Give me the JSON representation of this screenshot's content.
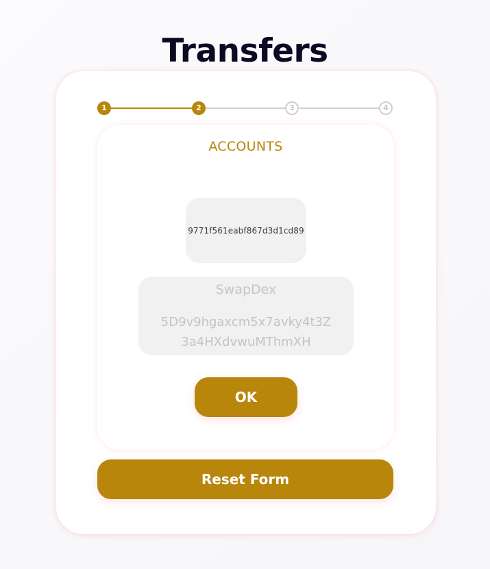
{
  "page": {
    "title": "Transfers"
  },
  "stepper": {
    "steps": [
      {
        "label": "1",
        "state": "completed"
      },
      {
        "label": "2",
        "state": "current"
      },
      {
        "label": "3",
        "state": "pending"
      },
      {
        "label": "4",
        "state": "pending"
      }
    ],
    "active_color": "#b8860b",
    "inactive_color": "#cfcfcf"
  },
  "accounts_step": {
    "title": "ACCOUNTS",
    "selected_address": "9771f561eabf867d3d1cd89",
    "account": {
      "name": "SwapDex",
      "address": "5D9v9hgaxcm5x7avky4t3Z3a4HXdvwuMThmXH"
    },
    "ok_label": "OK"
  },
  "form": {
    "reset_label": "Reset Form"
  },
  "colors": {
    "accent": "#b8860b",
    "title": "#0c0a23",
    "muted_text": "#c4c4c4",
    "field_background": "#f1f1f1"
  }
}
